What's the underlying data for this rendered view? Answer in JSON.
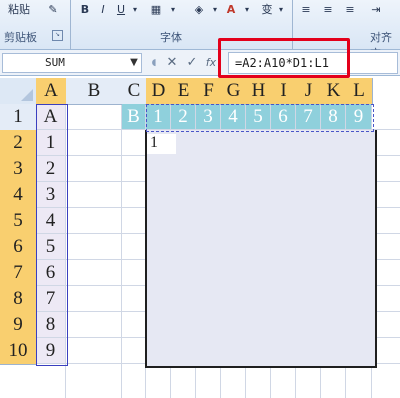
{
  "ribbon": {
    "clipboard_label": "剪贴板",
    "paste_label": "粘贴",
    "font_group_label": "字体",
    "align_group_label": "对齐方",
    "bold": "B",
    "italic": "I",
    "underline": "U",
    "change_label": "变"
  },
  "formula_bar": {
    "name_box_value": "SUM",
    "cancel_icon": "✕",
    "enter_icon": "✓",
    "fx_icon": "fx",
    "formula_value": "=A2:A10*D1:L1"
  },
  "columns": [
    "A",
    "B",
    "C",
    "D",
    "E",
    "F",
    "G",
    "H",
    "I",
    "J",
    "K",
    "L"
  ],
  "rows": [
    "1",
    "2",
    "3",
    "4",
    "5",
    "6",
    "7",
    "8",
    "9",
    "10"
  ],
  "row1_values": {
    "A": "A",
    "C": "B",
    "D": "1",
    "E": "2",
    "F": "3",
    "G": "4",
    "H": "5",
    "I": "6",
    "J": "7",
    "K": "8",
    "L": "9"
  },
  "colA_values": [
    "1",
    "2",
    "3",
    "4",
    "5",
    "6",
    "7",
    "8",
    "9"
  ],
  "active_cell_text": "1",
  "colors": {
    "accent_selected_header": "#f9cf6f",
    "row1_fill": "#8fd0dc",
    "highlight_box": "#e3001b"
  }
}
